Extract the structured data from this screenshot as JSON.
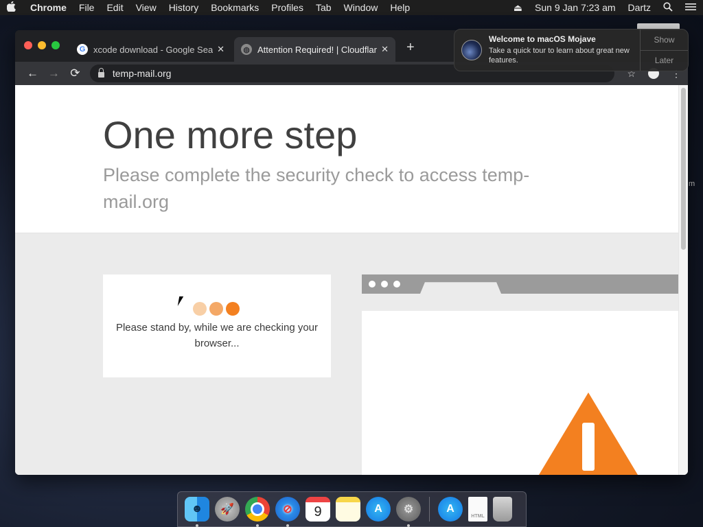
{
  "menubar": {
    "apple_icon": "apple-icon",
    "app_name": "Chrome",
    "menus": [
      "File",
      "Edit",
      "View",
      "History",
      "Bookmarks",
      "Profiles",
      "Tab",
      "Window",
      "Help"
    ],
    "eject_icon": "⏏",
    "datetime": "Sun 9 Jan  7:23 am",
    "user": "Dartz",
    "search_icon": "search-icon",
    "list_icon": "control-center-icon"
  },
  "browser": {
    "tabs": [
      {
        "title": "xcode download - Google Sear",
        "favicon": "G",
        "active": false
      },
      {
        "title": "Attention Required! | Cloudflare",
        "favicon": "globe",
        "active": true
      }
    ],
    "new_tab_label": "+",
    "url": "temp-mail.org",
    "back_label": "←",
    "forward_label": "→",
    "reload_label": "⟳",
    "star_label": "☆",
    "menu_label": "⋮"
  },
  "page": {
    "heading": "One more step",
    "subheading": "Please complete the security check to access temp-mail.org",
    "status_message": "Please stand by, while we are checking your browser...",
    "loading_dot_colors": [
      "#f8cfa6",
      "#f4a866",
      "#f38020"
    ],
    "warning_color": "#f38020"
  },
  "notification": {
    "title": "Welcome to macOS Mojave",
    "body": "Take a quick tour to learn about great new features.",
    "show_label": "Show",
    "later_label": "Later"
  },
  "side_text": "m",
  "dock": {
    "items": [
      {
        "name": "finder",
        "label": "☻",
        "running": true
      },
      {
        "name": "launchpad",
        "label": "🚀",
        "running": false
      },
      {
        "name": "chrome",
        "label": "",
        "running": true
      },
      {
        "name": "safari",
        "label": "⊘",
        "running": true
      },
      {
        "name": "calendar",
        "label": "9",
        "running": false
      },
      {
        "name": "notes",
        "label": "",
        "running": false
      },
      {
        "name": "app-store",
        "label": "A",
        "running": false
      },
      {
        "name": "system-preferences",
        "label": "⚙",
        "running": true
      },
      {
        "name": "app-store-installer",
        "label": "A",
        "running": false
      },
      {
        "name": "html-file",
        "label": "HTML",
        "running": false
      },
      {
        "name": "trash",
        "label": "",
        "running": false
      }
    ]
  }
}
